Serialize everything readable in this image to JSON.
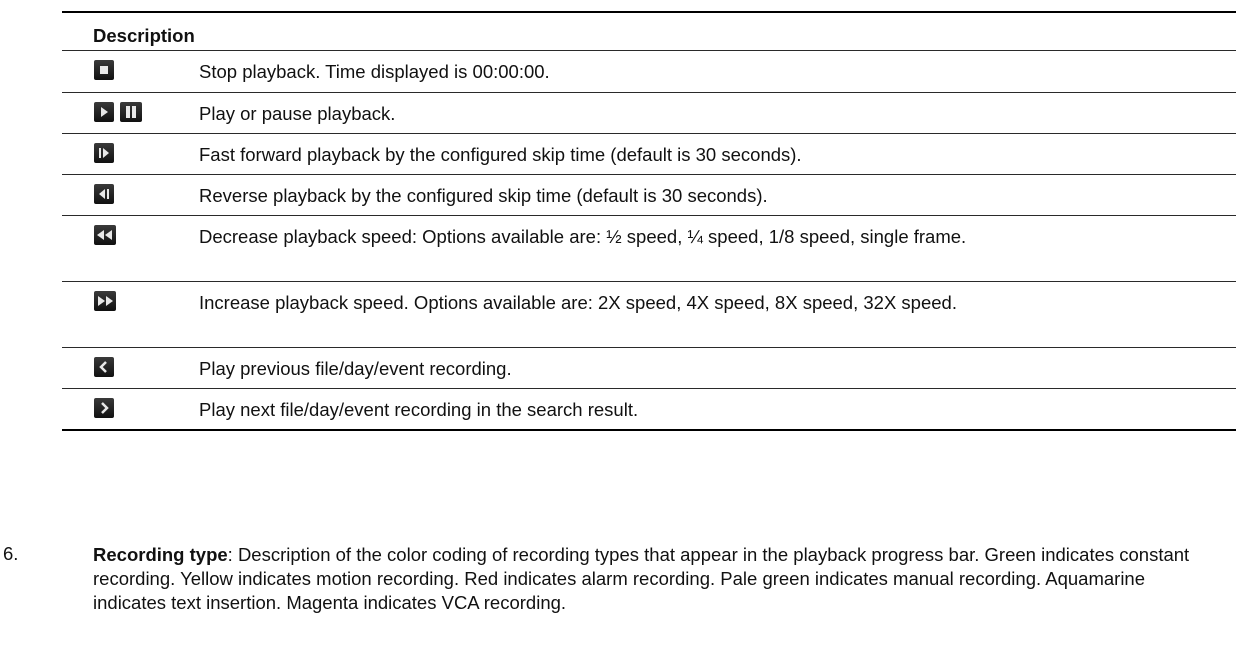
{
  "table": {
    "header": "Description",
    "rows": [
      {
        "icons": [
          "stop-icon"
        ],
        "text": "Stop playback. Time displayed is 00:00:00."
      },
      {
        "icons": [
          "play-icon",
          "pause-icon"
        ],
        "text": "Play or pause playback."
      },
      {
        "icons": [
          "skip-forward-icon"
        ],
        "text": "Fast forward playback by the configured skip time (default is 30 seconds)."
      },
      {
        "icons": [
          "skip-back-icon"
        ],
        "text": "Reverse playback by the configured skip time (default is 30 seconds)."
      },
      {
        "icons": [
          "slow-down-icon"
        ],
        "text": "Decrease playback speed: Options available are: ½ speed, ¼ speed, 1/8 speed, single frame."
      },
      {
        "icons": [
          "speed-up-icon"
        ],
        "text": "Increase playback speed. Options available are: 2X speed, 4X speed, 8X speed, 32X speed."
      },
      {
        "icons": [
          "previous-icon"
        ],
        "text": "Play previous file/day/event recording."
      },
      {
        "icons": [
          "next-icon"
        ],
        "text": "Play next file/day/event recording in the search result."
      }
    ]
  },
  "item": {
    "number": "6.",
    "term": "Recording type",
    "body": ": Description of the color coding of recording types that appear in the playback progress bar. Green indicates constant recording. Yellow indicates motion recording. Red indicates alarm recording. Pale green indicates manual recording. Aquamarine indicates text insertion. Magenta indicates VCA recording."
  }
}
